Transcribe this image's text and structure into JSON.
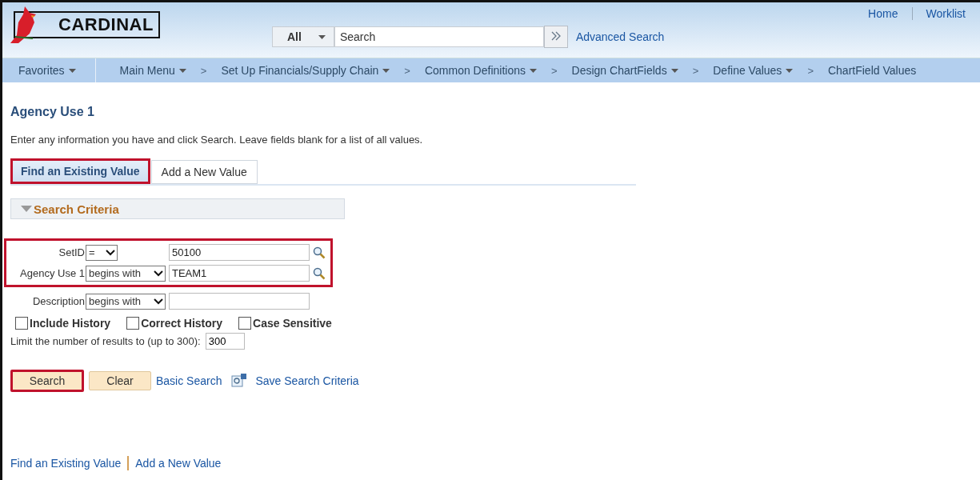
{
  "header": {
    "logo": "CARDINAL",
    "search": {
      "scope": "All",
      "placeholder": "Search"
    },
    "advanced_search": "Advanced Search",
    "links": [
      "Home",
      "Worklist"
    ]
  },
  "nav": [
    {
      "label": "Favorites",
      "dropdown": true
    },
    {
      "label": "Main Menu",
      "dropdown": true
    },
    {
      "prefix": ">",
      "label": "Set Up Financials/Supply Chain",
      "dropdown": true
    },
    {
      "prefix": ">",
      "label": "Common Definitions",
      "dropdown": true
    },
    {
      "prefix": ">",
      "label": "Design ChartFields",
      "dropdown": true
    },
    {
      "prefix": ">",
      "label": "Define Values",
      "dropdown": true
    },
    {
      "prefix": ">",
      "label": "ChartField Values",
      "dropdown": false
    }
  ],
  "page_title": "Agency Use 1",
  "instructions": "Enter any information you have and click Search. Leave fields blank for a list of all values.",
  "tabs": [
    {
      "label": "Find an Existing Value",
      "selected": true,
      "highlighted": true
    },
    {
      "label": "Add a New Value",
      "selected": false,
      "highlighted": false
    }
  ],
  "section": {
    "title": "Search Criteria",
    "expanded": true
  },
  "criteria": [
    {
      "label": "SetID",
      "operator": "=",
      "value": "50100",
      "lookup": true,
      "highlighted": true
    },
    {
      "label": "Agency Use 1",
      "operator": "begins with",
      "value": "TEAM1",
      "lookup": true,
      "highlighted": true
    },
    {
      "label": "Description",
      "operator": "begins with",
      "lookup": false,
      "highlighted": false
    }
  ],
  "options": [
    {
      "label": "Include History",
      "checked": false
    },
    {
      "label": "Correct History",
      "checked": false
    },
    {
      "label": "Case Sensitive",
      "checked": false
    }
  ],
  "limit": {
    "label": "Limit the number of results to (up to 300):",
    "value": "300"
  },
  "buttons": [
    {
      "label": "Search",
      "highlighted": true
    },
    {
      "label": "Clear",
      "highlighted": false
    }
  ],
  "basic_search": "Basic Search",
  "save_search": "Save Search Criteria",
  "footer_links": [
    "Find an Existing Value",
    "Add a New Value"
  ]
}
